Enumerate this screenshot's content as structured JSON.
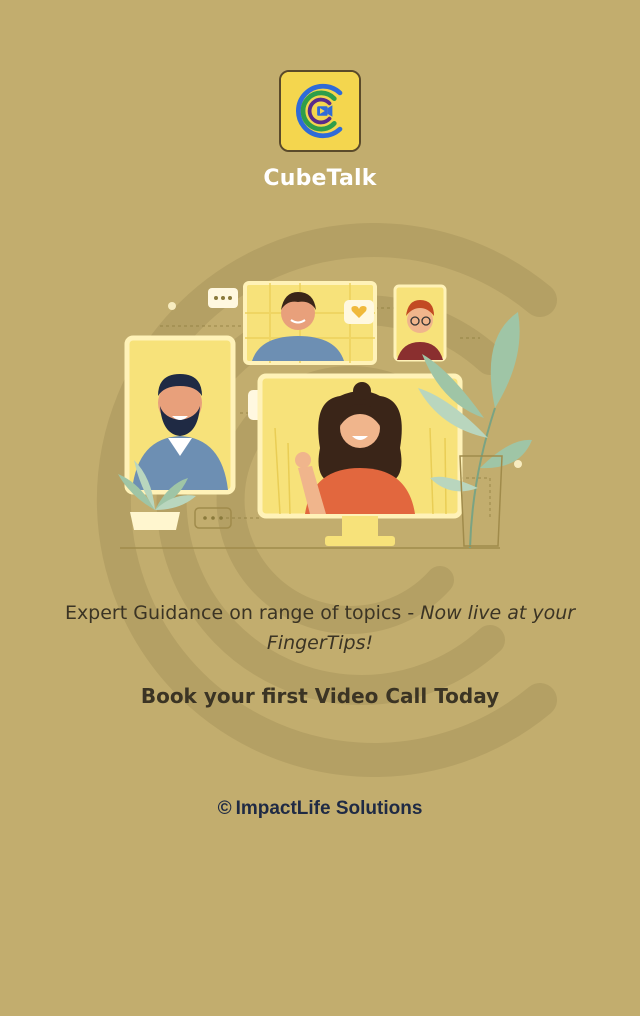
{
  "app": {
    "name": "CubeTalk",
    "logo_icon": "cubetalk-logo-icon",
    "logo_bg_color": "#f4d64e"
  },
  "hero": {
    "illustration": "video-call-group-illustration"
  },
  "tagline": {
    "plain": "Expert Guidance on range of topics - ",
    "emphasis": "Now live at your FingerTips!"
  },
  "cta": {
    "text": "Book your first Video Call Today"
  },
  "footer": {
    "copyright_symbol": "©",
    "company": "ImpactLife Solutions"
  },
  "colors": {
    "background": "#c2ad6e",
    "accent_yellow": "#f4d64e",
    "text_dark": "#3b3424",
    "footer_text": "#1f2a44"
  }
}
